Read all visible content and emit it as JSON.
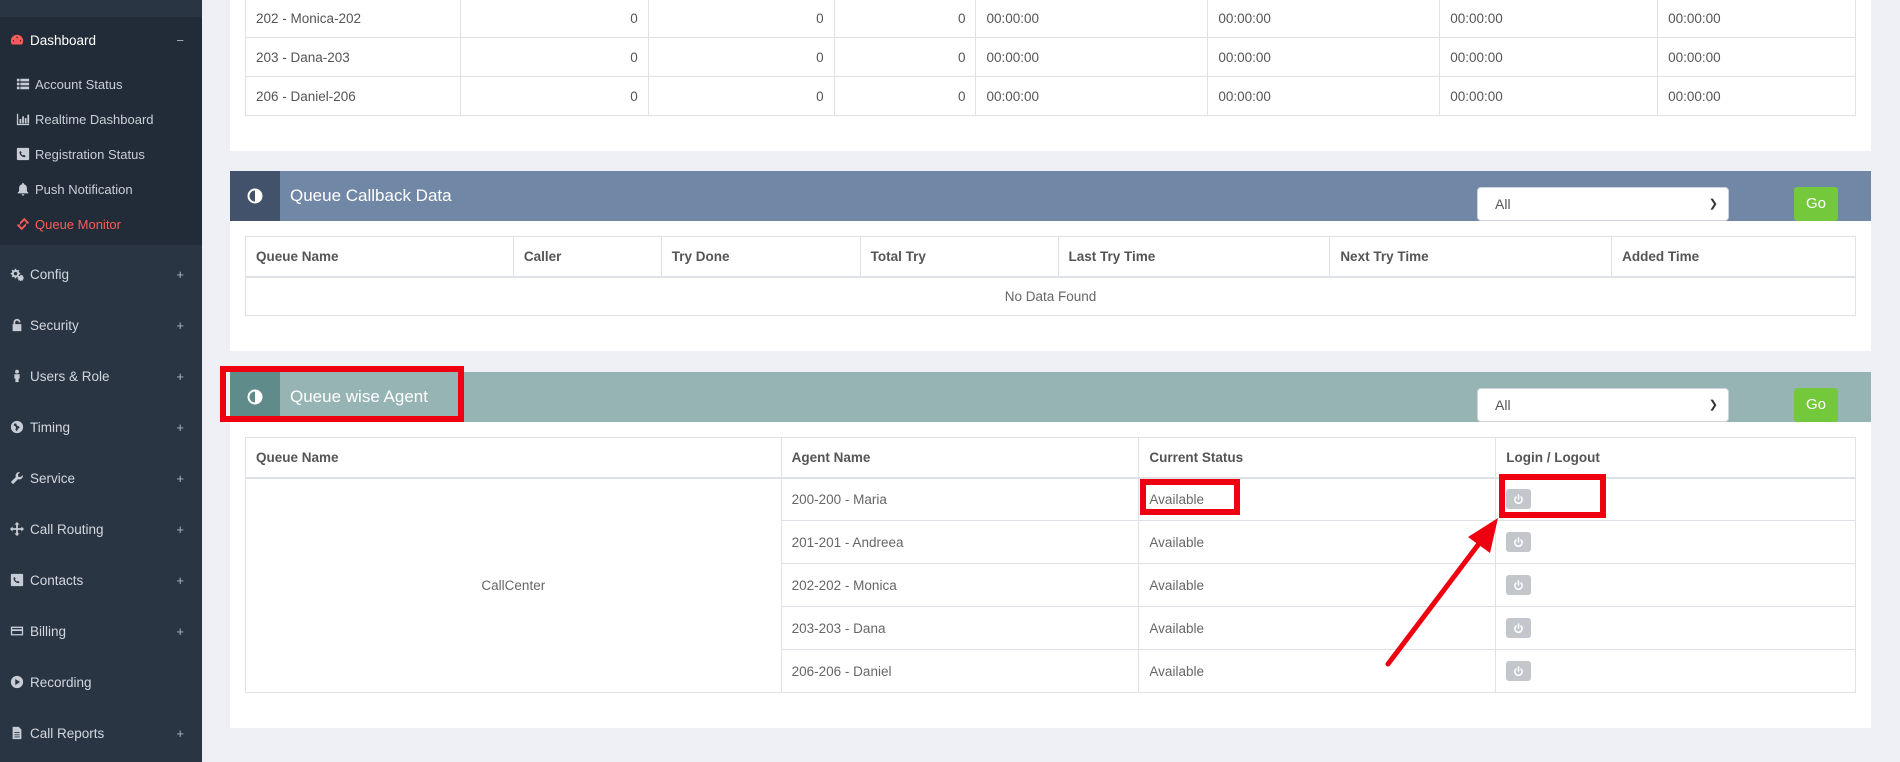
{
  "sidebar": {
    "dashboard": "Dashboard",
    "dashboard_toggle": "−",
    "children": [
      {
        "label": "Account Status",
        "icon": "list-icon"
      },
      {
        "label": "Realtime Dashboard",
        "icon": "bar-chart-icon"
      },
      {
        "label": "Registration Status",
        "icon": "phone-square-icon"
      },
      {
        "label": "Push Notification",
        "icon": "bell-icon"
      },
      {
        "label": "Queue Monitor",
        "icon": "ticket-icon"
      }
    ],
    "items": [
      {
        "label": "Config",
        "icon": "gears-icon",
        "toggle": "+"
      },
      {
        "label": "Security",
        "icon": "lock-icon",
        "toggle": "+"
      },
      {
        "label": "Users & Role",
        "icon": "user-icon",
        "toggle": "+"
      },
      {
        "label": "Timing",
        "icon": "globe-icon",
        "toggle": "+"
      },
      {
        "label": "Service",
        "icon": "wrench-icon",
        "toggle": "+"
      },
      {
        "label": "Call Routing",
        "icon": "arrows-icon",
        "toggle": "+"
      },
      {
        "label": "Contacts",
        "icon": "phone-square-icon",
        "toggle": "+"
      },
      {
        "label": "Billing",
        "icon": "credit-card-icon",
        "toggle": "+"
      },
      {
        "label": "Recording",
        "icon": "play-circle-icon",
        "toggle": ""
      },
      {
        "label": "Call Reports",
        "icon": "file-icon",
        "toggle": "+"
      }
    ]
  },
  "top_table": {
    "rows": [
      [
        "202 - Monica-202",
        "0",
        "0",
        "0",
        "00:00:00",
        "00:00:00",
        "00:00:00",
        "00:00:00"
      ],
      [
        "203 - Dana-203",
        "0",
        "0",
        "0",
        "00:00:00",
        "00:00:00",
        "00:00:00",
        "00:00:00"
      ],
      [
        "206 - Daniel-206",
        "0",
        "0",
        "0",
        "00:00:00",
        "00:00:00",
        "00:00:00",
        "00:00:00"
      ]
    ]
  },
  "callback": {
    "title": "Queue Callback Data",
    "select_value": "All",
    "go_label": "Go",
    "columns": [
      "Queue Name",
      "Caller",
      "Try Done",
      "Total Try",
      "Last Try Time",
      "Next Try Time",
      "Added Time"
    ],
    "empty_text": "No Data Found"
  },
  "queue_agent": {
    "title": "Queue wise Agent",
    "select_value": "All",
    "go_label": "Go",
    "columns": [
      "Queue Name",
      "Agent Name",
      "Current Status",
      "Login / Logout"
    ],
    "queue_name": "CallCenter",
    "rows": [
      {
        "agent": "200-200 - Maria",
        "status": "Available"
      },
      {
        "agent": "201-201 - Andreea",
        "status": "Available"
      },
      {
        "agent": "202-202 - Monica",
        "status": "Available"
      },
      {
        "agent": "203-203 - Dana",
        "status": "Available"
      },
      {
        "agent": "206-206 - Daniel",
        "status": "Available"
      }
    ]
  },
  "colors": {
    "sidebar_bg": "#2a3543",
    "accent_red": "#ff5a5a",
    "callback_header": "#7187a6",
    "callback_icon": "#42526b",
    "agent_header": "#97b4b4",
    "agent_icon": "#5f8b8b",
    "go_button": "#73c83c",
    "annotation": "#ee0010"
  }
}
